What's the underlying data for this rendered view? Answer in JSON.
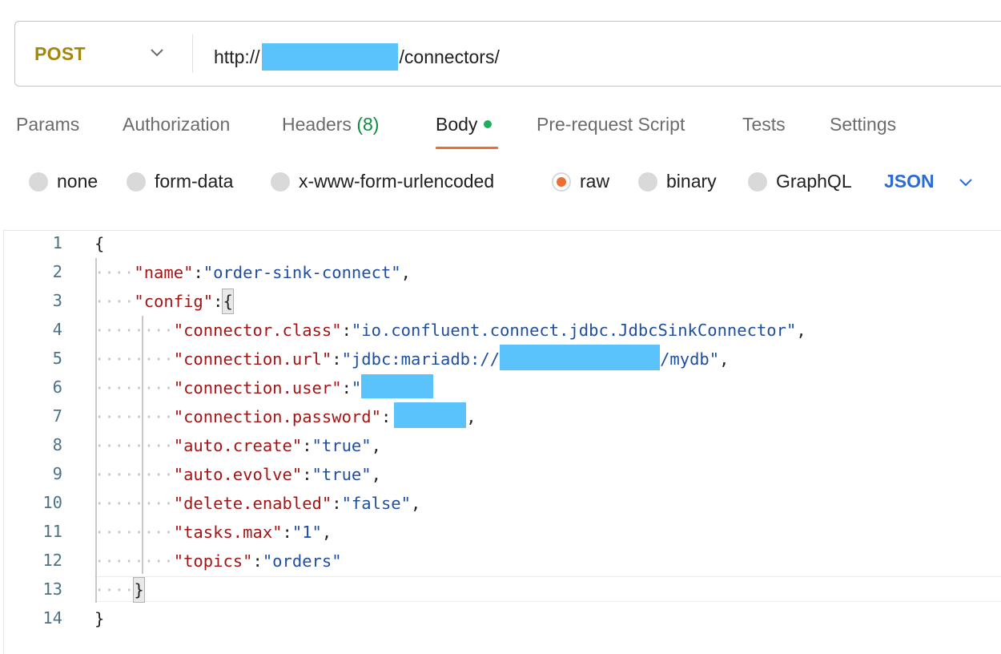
{
  "request": {
    "method": "POST",
    "url_prefix": "http://",
    "url_suffix": "/connectors/"
  },
  "tabs": [
    {
      "label": "Params"
    },
    {
      "label": "Authorization"
    },
    {
      "label": "Headers",
      "count": "(8)"
    },
    {
      "label": "Body",
      "active": true
    },
    {
      "label": "Pre-request Script"
    },
    {
      "label": "Tests"
    },
    {
      "label": "Settings"
    }
  ],
  "body_types": [
    {
      "label": "none"
    },
    {
      "label": "form-data"
    },
    {
      "label": "x-www-form-urlencoded"
    },
    {
      "label": "raw",
      "selected": true
    },
    {
      "label": "binary"
    },
    {
      "label": "GraphQL"
    }
  ],
  "language": "JSON",
  "editor": {
    "line_numbers": [
      "1",
      "2",
      "3",
      "4",
      "5",
      "6",
      "7",
      "8",
      "9",
      "10",
      "11",
      "12",
      "13",
      "14"
    ],
    "lines": [
      {
        "text": "{"
      },
      {
        "key": "\"name\"",
        "sep": ":",
        "val": "\"order-sink-connect\"",
        "end": ","
      },
      {
        "key": "\"config\"",
        "sep": ":",
        "val": "{"
      },
      {
        "key": "\"connector.class\"",
        "sep": ":",
        "val": "\"io.confluent.connect.jdbc.JdbcSinkConnector\"",
        "end": ","
      },
      {
        "key": "\"connection.url\"",
        "sep": ":",
        "val": "\"jdbc:mariadb://",
        "val2": "/mydb\"",
        "end": ","
      },
      {
        "key": "\"connection.user\"",
        "sep": ":",
        "val": "\""
      },
      {
        "key": "\"connection.password\"",
        "sep": ":",
        "end": ","
      },
      {
        "key": "\"auto.create\"",
        "sep": ":",
        "val": "\"true\"",
        "end": ","
      },
      {
        "key": "\"auto.evolve\"",
        "sep": ":",
        "val": "\"true\"",
        "end": ","
      },
      {
        "key": "\"delete.enabled\"",
        "sep": ":",
        "val": "\"false\"",
        "end": ","
      },
      {
        "key": "\"tasks.max\"",
        "sep": ":",
        "val": "\"1\"",
        "end": ","
      },
      {
        "key": "\"topics\"",
        "sep": ":",
        "val": "\"orders\""
      },
      {
        "text": "}"
      },
      {
        "text": "}"
      }
    ]
  },
  "colors": {
    "method": "#a5860c",
    "active_tab_underline": "#ee6d33",
    "redaction": "#5bc3fb",
    "json_key": "#a31515",
    "json_string": "#1f4ea0"
  }
}
